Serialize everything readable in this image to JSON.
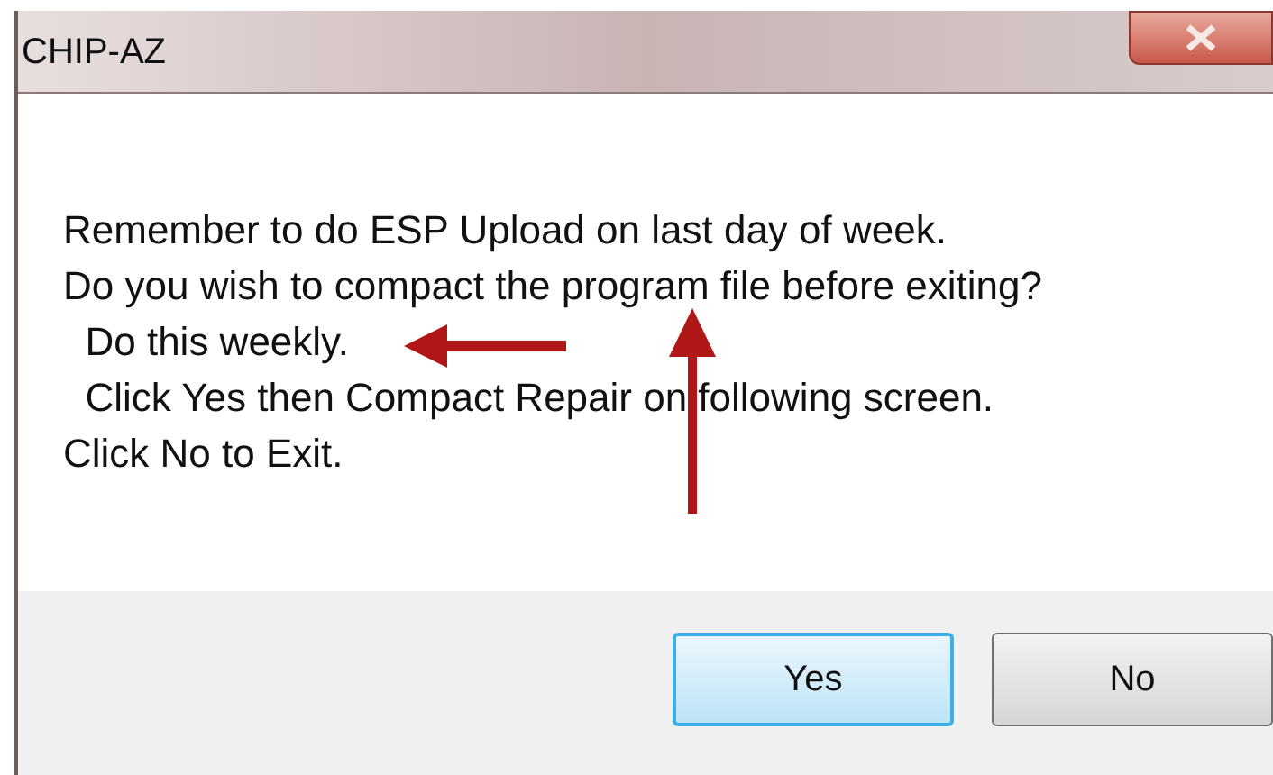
{
  "window": {
    "title": "CHIP-AZ"
  },
  "message": [
    "Remember to do ESP Upload on last day of week.",
    "Do you wish to compact the program file before exiting?",
    "  Do this weekly.",
    "  Click Yes then Compact Repair on following screen.",
    "Click No to Exit."
  ],
  "buttons": [
    {
      "label": "Yes",
      "selected": true
    },
    {
      "label": "No",
      "selected": false
    }
  ]
}
